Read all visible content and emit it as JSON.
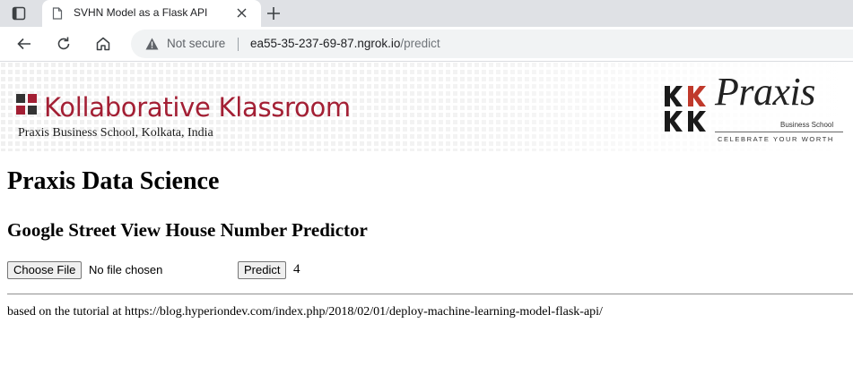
{
  "browser": {
    "tab_title": "SVHN Model as a Flask API",
    "security_label": "Not secure",
    "url_host": "ea55-35-237-69-87.ngrok.io",
    "url_path": "/predict"
  },
  "banner": {
    "brand_title": "Kollaborative Klassroom",
    "brand_subtitle": "Praxis Business School, Kolkata, India",
    "praxis_name": "Praxis",
    "praxis_sub": "Business School",
    "praxis_tagline": "CELEBRATE YOUR WORTH"
  },
  "page": {
    "heading": "Praxis Data Science",
    "subheading": "Google Street View House Number Predictor",
    "choose_file_label": "Choose File",
    "no_file_text": "No file chosen",
    "predict_label": "Predict",
    "prediction": "4",
    "footer_text": "based on the tutorial at https://blog.hyperiondev.com/index.php/2018/02/01/deploy-machine-learning-model-flask-api/"
  },
  "colors": {
    "brand_red": "#a31f34",
    "chrome_gray": "#dfe1e5"
  }
}
